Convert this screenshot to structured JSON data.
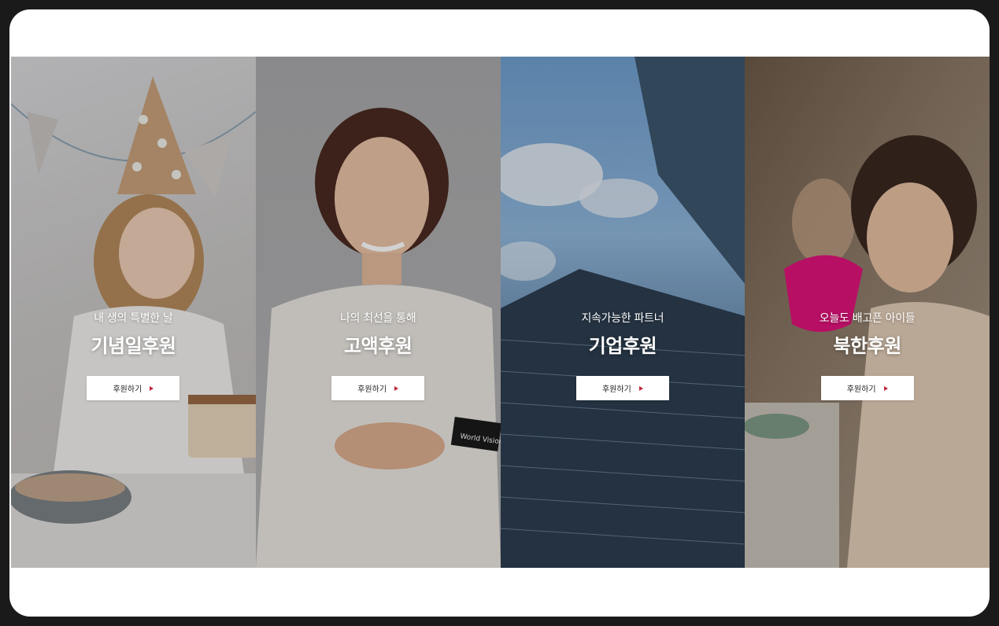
{
  "panels": [
    {
      "subtitle": "내 생의 특별한 날",
      "title": "기념일후원",
      "button": "후원하기"
    },
    {
      "subtitle": "나의 최선을 통해",
      "title": "고액후원",
      "button": "후원하기"
    },
    {
      "subtitle": "지속가능한 파트너",
      "title": "기업후원",
      "button": "후원하기"
    },
    {
      "subtitle": "오늘도 배고픈 아이들",
      "title": "북한후원",
      "button": "후원하기"
    }
  ],
  "photo_text": {
    "card": "World Vision"
  },
  "colors": {
    "frame": "#1a1a1a",
    "accent": "#c0273a"
  }
}
